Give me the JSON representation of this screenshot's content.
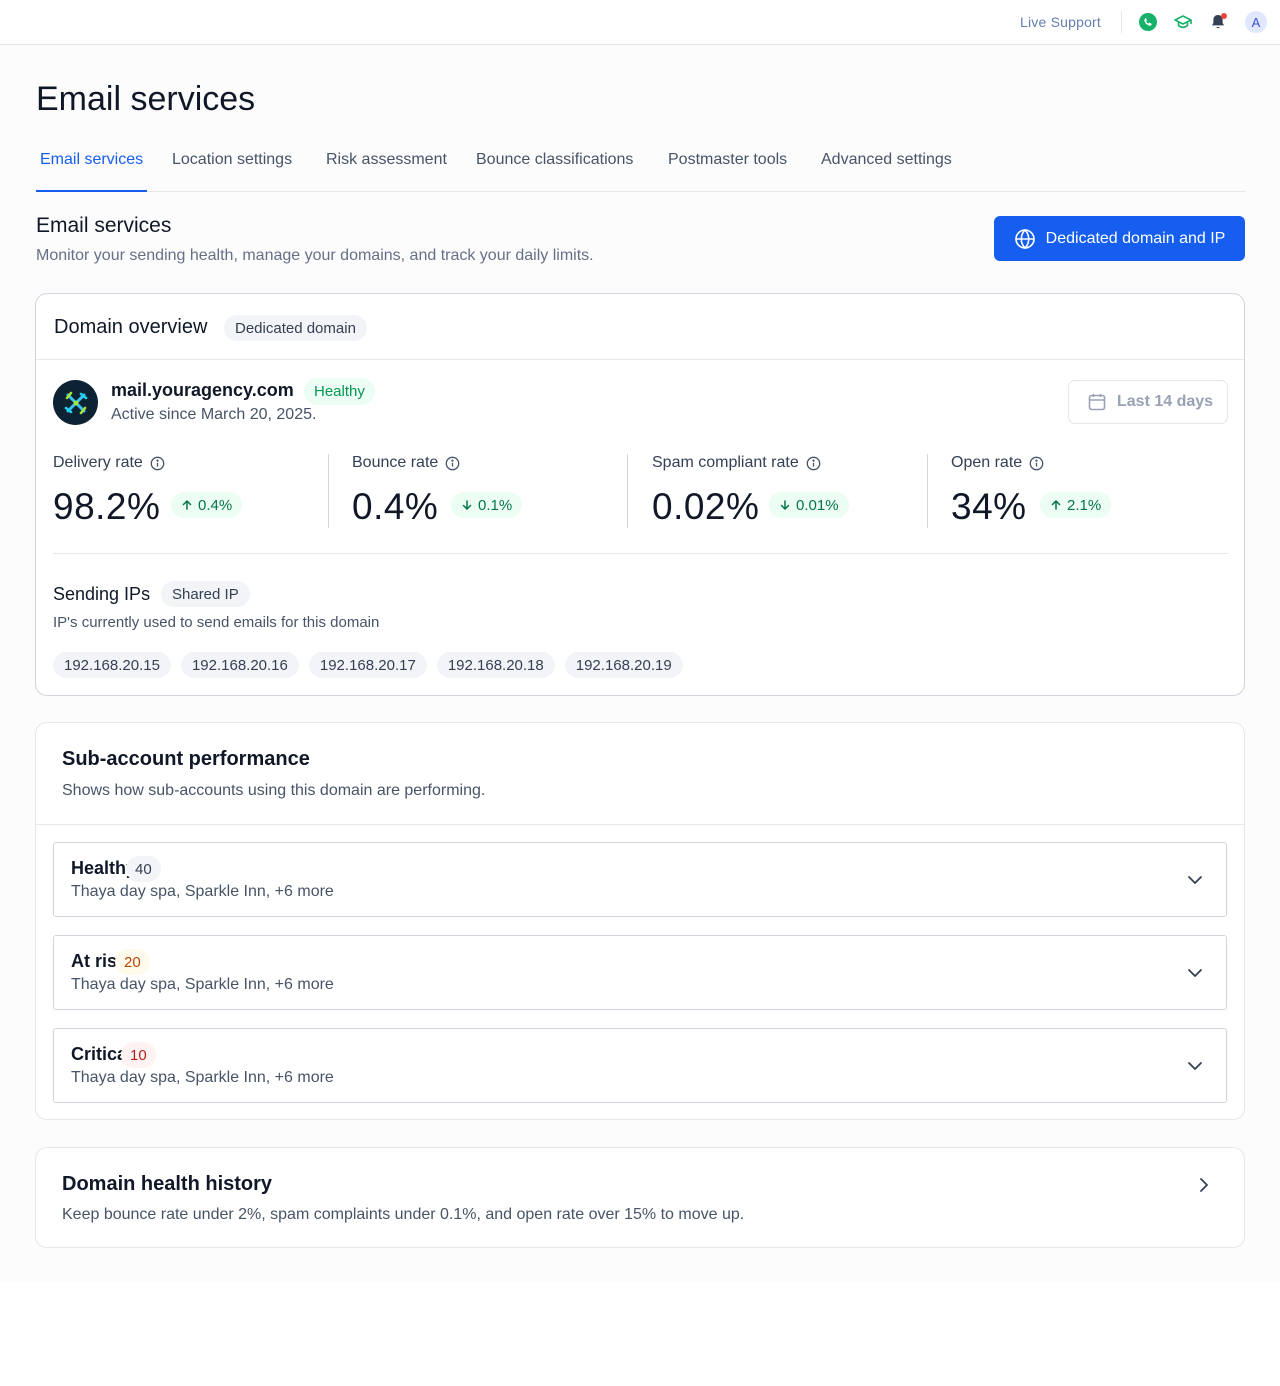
{
  "topbar": {
    "live_support": "Live Support",
    "avatar_initial": "A",
    "icons": [
      "phone-icon",
      "graduation-cap-icon",
      "bell-icon"
    ],
    "notification_dot_color": "#f04438"
  },
  "page": {
    "title": "Email services"
  },
  "tabs": [
    {
      "label": "Email services",
      "active": true
    },
    {
      "label": "Location settings",
      "active": false
    },
    {
      "label": "Risk assessment",
      "active": false
    },
    {
      "label": "Bounce classifications",
      "active": false
    },
    {
      "label": "Postmaster tools",
      "active": false
    },
    {
      "label": "Advanced settings",
      "active": false
    }
  ],
  "section": {
    "title": "Email services",
    "description": "Monitor your sending health, manage your domains, and track your daily limits.",
    "primary_button": "Dedicated domain and IP"
  },
  "domain_overview": {
    "title": "Domain overview",
    "badge": "Dedicated domain",
    "domain": "mail.youragency.com",
    "status": "Healthy",
    "active_since": "Active since March 20, 2025.",
    "date_range": "Last 14 days",
    "metrics": [
      {
        "label": "Delivery rate",
        "value": "98.2%",
        "delta": "0.4%",
        "direction": "up"
      },
      {
        "label": "Bounce rate",
        "value": "0.4%",
        "delta": "0.1%",
        "direction": "down"
      },
      {
        "label": "Spam compliant rate",
        "value": "0.02%",
        "delta": "0.01%",
        "direction": "down"
      },
      {
        "label": "Open rate",
        "value": "34%",
        "delta": "2.1%",
        "direction": "up"
      }
    ],
    "sending_ips": {
      "title": "Sending IPs",
      "badge": "Shared IP",
      "description": "IP's currently used to send emails for this domain",
      "ips": [
        "192.168.20.15",
        "192.168.20.16",
        "192.168.20.17",
        "192.168.20.18",
        "192.168.20.19"
      ]
    }
  },
  "sub_accounts": {
    "title": "Sub-account performance",
    "description": "Shows how sub-accounts using this domain are performing.",
    "groups": [
      {
        "label": "Healthy",
        "count": "40",
        "accounts": "Thaya day spa, Sparkle Inn, +6 more",
        "count_bg": "#f2f4f7",
        "count_color": "#344054"
      },
      {
        "label": "At risk",
        "count": "20",
        "accounts": "Thaya day spa, Sparkle Inn, +6 more",
        "count_bg": "#fffaeb",
        "count_color": "#b54708"
      },
      {
        "label": "Critical",
        "count": "10",
        "accounts": "Thaya day spa, Sparkle Inn, +6 more",
        "count_bg": "#fef3f2",
        "count_color": "#b42318"
      }
    ]
  },
  "health_history": {
    "title": "Domain health history",
    "description": "Keep bounce rate under 2%, spam complaints under 0.1%, and open rate over 15% to move up."
  },
  "colors": {
    "accent": "#155eef",
    "success": "#079455",
    "border": "#d0d5dd"
  }
}
